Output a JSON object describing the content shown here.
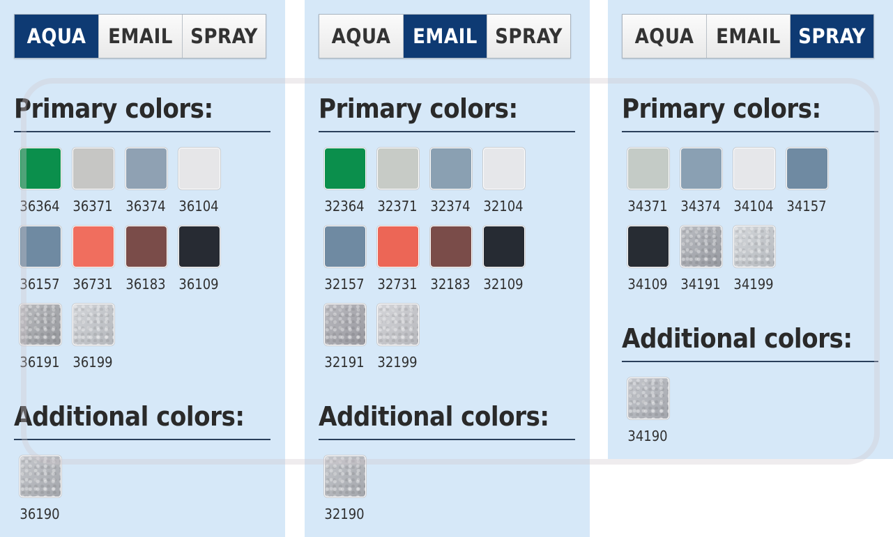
{
  "panels": [
    {
      "tabs": [
        "AQUA",
        "EMAIL",
        "SPRAY"
      ],
      "active_tab": 0,
      "primary_heading": "Primary colors:",
      "additional_heading": "Additional colors:",
      "primary": [
        {
          "code": "36364",
          "color": "#0b8f4c"
        },
        {
          "code": "36371",
          "color": "#c6c6c4"
        },
        {
          "code": "36374",
          "color": "#8fa1b3"
        },
        {
          "code": "36104",
          "color": "#e6e6e8"
        },
        {
          "code": "36157",
          "color": "#6f8aa2"
        },
        {
          "code": "36731",
          "color": "#f06e5e"
        },
        {
          "code": "36183",
          "color": "#7a4c49"
        },
        {
          "code": "36109",
          "color": "#272b33"
        },
        {
          "code": "36191",
          "color": "#a2a4a9"
        },
        {
          "code": "36199",
          "color": "#c4c7cc"
        }
      ],
      "additional": [
        {
          "code": "36190",
          "color": "#b1b4ba"
        }
      ]
    },
    {
      "tabs": [
        "AQUA",
        "EMAIL",
        "SPRAY"
      ],
      "active_tab": 1,
      "primary_heading": "Primary colors:",
      "additional_heading": "Additional colors:",
      "primary": [
        {
          "code": "32364",
          "color": "#0b8f4c"
        },
        {
          "code": "32371",
          "color": "#c7cbc6"
        },
        {
          "code": "32374",
          "color": "#8aa0b2"
        },
        {
          "code": "32104",
          "color": "#e6e7ea"
        },
        {
          "code": "32157",
          "color": "#6f8aa2"
        },
        {
          "code": "32731",
          "color": "#ec6656"
        },
        {
          "code": "32183",
          "color": "#7a4c49"
        },
        {
          "code": "32109",
          "color": "#262b33"
        },
        {
          "code": "32191",
          "color": "#a4a4ab"
        },
        {
          "code": "32199",
          "color": "#c6c7cc"
        }
      ],
      "additional": [
        {
          "code": "32190",
          "color": "#b1b4ba"
        }
      ]
    },
    {
      "tabs": [
        "AQUA",
        "EMAIL",
        "SPRAY"
      ],
      "active_tab": 2,
      "primary_heading": "Primary colors:",
      "additional_heading": "Additional colors:",
      "primary": [
        {
          "code": "34371",
          "color": "#c4cbc6"
        },
        {
          "code": "34374",
          "color": "#8aa0b3"
        },
        {
          "code": "34104",
          "color": "#e6e7ea"
        },
        {
          "code": "34157",
          "color": "#6f8aa2"
        },
        {
          "code": "34109",
          "color": "#272c33"
        },
        {
          "code": "34191",
          "color": "#a3a6ad"
        },
        {
          "code": "34199",
          "color": "#c5c9ce"
        }
      ],
      "additional": [
        {
          "code": "34190",
          "color": "#b1b4bb"
        }
      ]
    }
  ]
}
